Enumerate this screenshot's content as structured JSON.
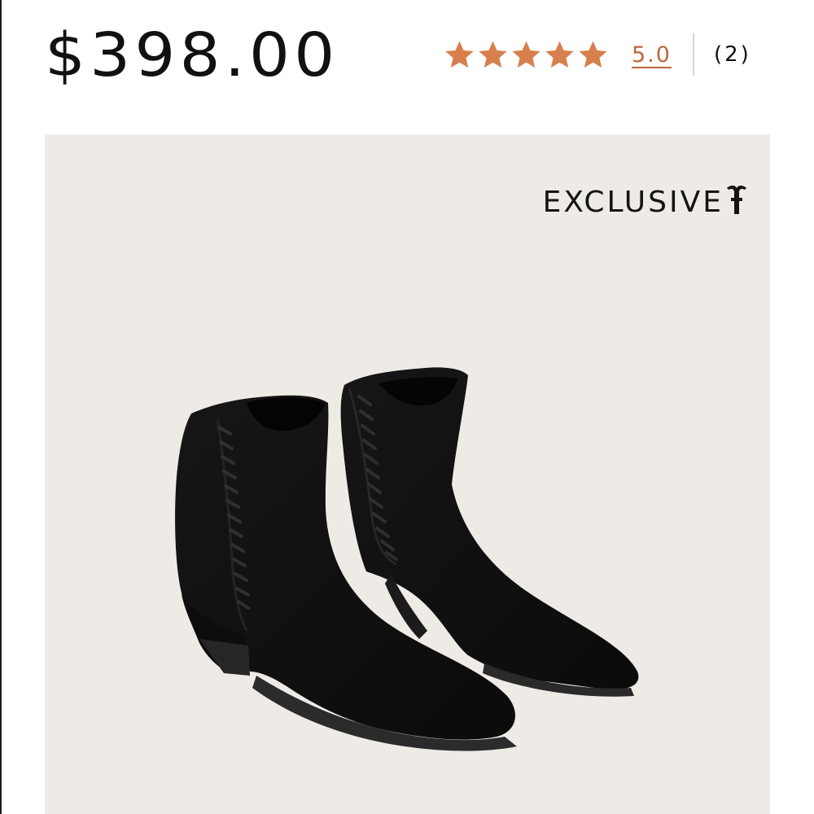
{
  "product": {
    "price": "$398.00"
  },
  "rating": {
    "value": "5.0",
    "review_count": "(2)",
    "stars_filled": 5,
    "stars_total": 5,
    "star_color": "#d7804d",
    "link_color": "#b86a3c"
  },
  "image": {
    "badge_text": "EXCLUSIVE",
    "badge_icon": "frye-logo-icon",
    "background_color": "#eeeae6",
    "product_color": "#111111"
  }
}
